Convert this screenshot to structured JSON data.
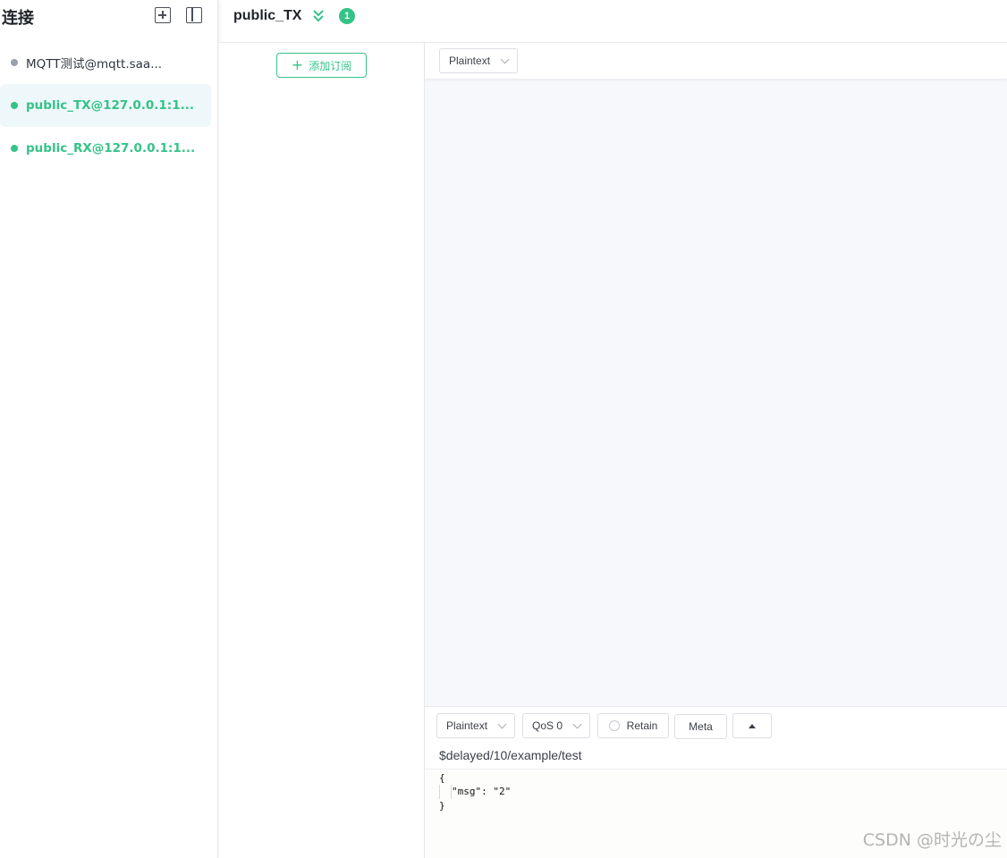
{
  "sidebar": {
    "title": "连接",
    "connections": [
      {
        "name": "MQTT测试@mqtt.saa...",
        "status": "offline"
      },
      {
        "name": "public_TX@127.0.0.1:1...",
        "status": "online",
        "active": true
      },
      {
        "name": "public_RX@127.0.0.1:1...",
        "status": "online"
      }
    ]
  },
  "header": {
    "title": "public_TX",
    "badge_count": "1"
  },
  "subscriptions": {
    "add_label": "添加订阅"
  },
  "messages": {
    "payload_type": "Plaintext"
  },
  "publish": {
    "payload_type": "Plaintext",
    "qos": "QoS 0",
    "retain_label": "Retain",
    "meta_label": "Meta",
    "topic": "$delayed/10/example/test",
    "payload_lines": [
      "{",
      "  \"msg\": \"2\"",
      "}"
    ]
  },
  "watermark": "CSDN @时光の尘",
  "colors": {
    "accent": "#34c388",
    "offline": "#9aa0aa"
  }
}
